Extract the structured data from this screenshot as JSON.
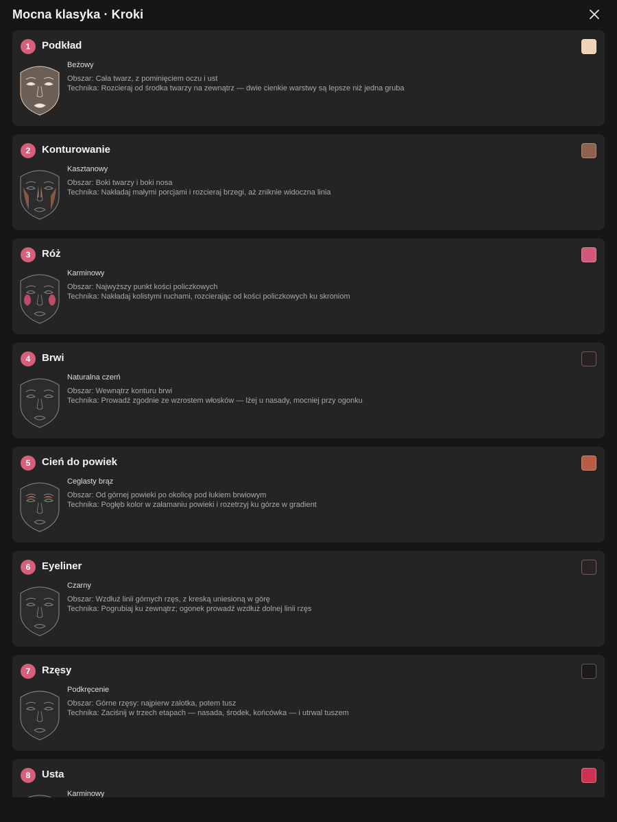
{
  "header": {
    "title": "Mocna klasyka · Kroki",
    "close_icon": "close-icon"
  },
  "steps": [
    {
      "number": "1",
      "title": "Podkład",
      "shade": "Beżowy",
      "swatch": "#f0d2b6",
      "area": "Obszar: Cała twarz, z pominięciem oczu i ust",
      "technique": "Technika: Rozcieraj od środka twarzy na zewnątrz — dwie cienkie warstwy są lepsze niż jedna gruba",
      "face_icon": "face-foundation-icon",
      "highlight": "#6b5f55"
    },
    {
      "number": "2",
      "title": "Konturowanie",
      "shade": "Kasztanowy",
      "swatch": "#8f614b",
      "area": "Obszar: Boki twarzy i boki nosa",
      "technique": "Technika: Nakładaj małymi porcjami i rozcieraj brzegi, aż zniknie widoczna linia",
      "face_icon": "face-contour-icon",
      "highlight": "#8f614b"
    },
    {
      "number": "3",
      "title": "Róż",
      "shade": "Karminowy",
      "swatch": "#d15a7a",
      "area": "Obszar: Najwyższy punkt kości policzkowych",
      "technique": "Technika: Nakładaj kolistymi ruchami, rozcierając od kości policzkowych ku skroniom",
      "face_icon": "face-blush-icon",
      "highlight": "#c04a6a"
    },
    {
      "number": "4",
      "title": "Brwi",
      "shade": "Naturalna czerń",
      "swatch": "#2a2220",
      "area": "Obszar: Wewnątrz konturu brwi",
      "technique": "Technika: Prowadź zgodnie ze wzrostem włosków — lżej u nasady, mocniej przy ogonku",
      "face_icon": "face-brows-icon",
      "highlight": "#2a2220"
    },
    {
      "number": "5",
      "title": "Cień do powiek",
      "shade": "Ceglasty brąz",
      "swatch": "#b65d43",
      "area": "Obszar: Od górnej powieki po okolicę pod łukiem brwiowym",
      "technique": "Technika: Pogłęb kolor w załamaniu powieki i rozetrzyj ku górze w gradient",
      "face_icon": "face-eyeshadow-icon",
      "highlight": "#c0603f"
    },
    {
      "number": "6",
      "title": "Eyeliner",
      "shade": "Czarny",
      "swatch": "#2b2322",
      "area": "Obszar: Wzdłuż linii górnych rzęs, z kreską uniesioną w górę",
      "technique": "Technika: Pogrubiaj ku zewnątrz; ogonek prowadź wzdłuż dolnej linii rzęs",
      "face_icon": "face-eyeliner-icon",
      "highlight": "#2b2322"
    },
    {
      "number": "7",
      "title": "Rzęsy",
      "shade": "Podkręcenie",
      "swatch": "#1e1a19",
      "area": "Obszar: Górne rzęsy: najpierw zalotka, potem tusz",
      "technique": "Technika: Zaciśnij w trzech etapach — nasada, środek, końcówka — i utrwal tuszem",
      "face_icon": "face-lashes-icon",
      "highlight": "#1e1a19"
    },
    {
      "number": "8",
      "title": "Usta",
      "shade": "Karminowy",
      "swatch": "#cc3352",
      "area": "",
      "technique": "",
      "face_icon": "face-lips-icon",
      "highlight": "#cc3352"
    }
  ]
}
